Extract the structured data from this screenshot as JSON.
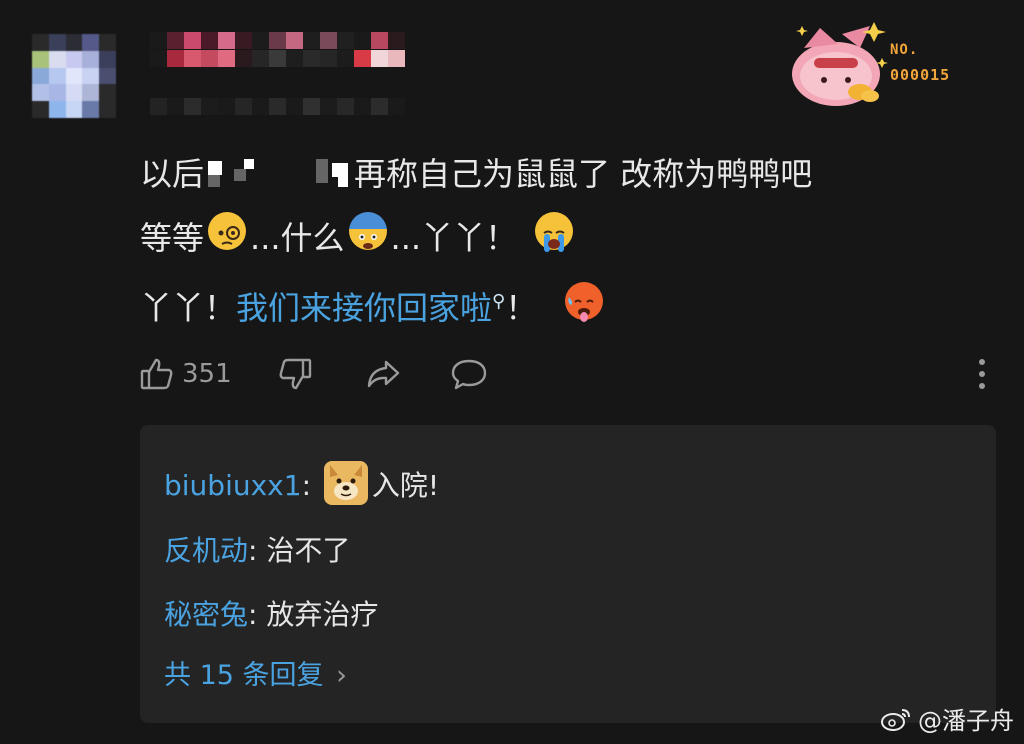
{
  "badge": {
    "no_label": "NO.",
    "number": "000015"
  },
  "comment": {
    "line1_start": "以后",
    "line1_end": "再称自己为鼠鼠了 改称为鸭鸭吧",
    "line2_a": "等等",
    "line2_b": "...什么",
    "line2_c": "...丫丫！",
    "line3_a": "丫丫！",
    "line3_link": "我们来接你回家啦",
    "line3_search_icon": "⚲",
    "line3_end": "！"
  },
  "actions": {
    "like_count": "351",
    "icons": [
      "thumbs-up-icon",
      "thumbs-down-icon",
      "share-icon",
      "comment-icon",
      "more-vertical-icon"
    ]
  },
  "replies": {
    "items": [
      {
        "user": "biubiuxx1",
        "sep": ":",
        "text": "入院!"
      },
      {
        "user": "反机动",
        "sep": ":",
        "text": "治不了"
      },
      {
        "user": "秘密兔",
        "sep": ":",
        "text": "放弃治疗"
      }
    ],
    "more_label": "共 15 条回复",
    "more_chevron": "›"
  },
  "watermark": {
    "handle": "@潘子舟"
  }
}
